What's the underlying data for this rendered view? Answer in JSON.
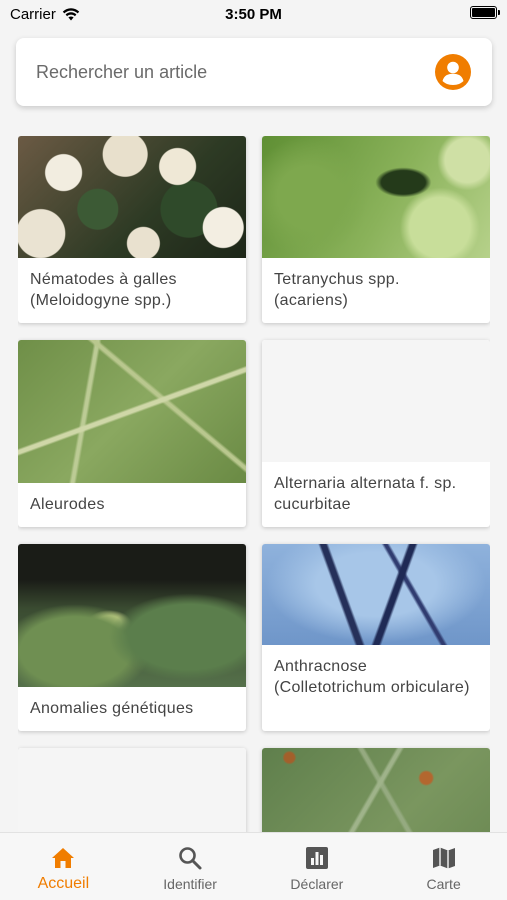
{
  "status_bar": {
    "carrier": "Carrier",
    "time": "3:50 PM"
  },
  "search": {
    "placeholder": "Rechercher un article",
    "account_icon": "account-circle-icon"
  },
  "colors": {
    "accent": "#f07d00",
    "inactive": "#666666"
  },
  "articles": [
    {
      "title": "Nématodes à galles (Meloidogyne spp.)"
    },
    {
      "title": "Tetranychus spp. (acariens)"
    },
    {
      "title": "Aleurodes"
    },
    {
      "title": "Alternaria alternata f. sp. cucurbitae"
    },
    {
      "title": "Anomalies génétiques"
    },
    {
      "title": "Anthracnose (Colletotrichum orbiculare)"
    },
    {
      "title": ""
    },
    {
      "title": ""
    }
  ],
  "bottom_nav": {
    "items": [
      {
        "label": "Accueil",
        "icon": "home-icon",
        "active": true
      },
      {
        "label": "Identifier",
        "icon": "search-icon",
        "active": false
      },
      {
        "label": "Déclarer",
        "icon": "bar-chart-icon",
        "active": false
      },
      {
        "label": "Carte",
        "icon": "map-icon",
        "active": false
      }
    ]
  }
}
